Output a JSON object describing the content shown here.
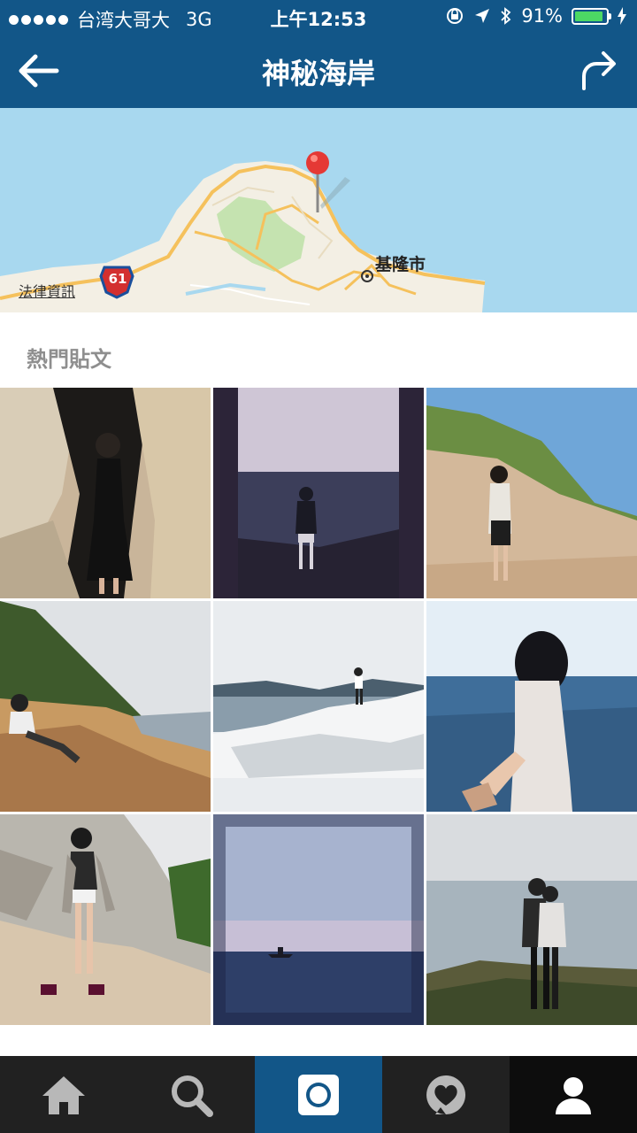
{
  "status_bar": {
    "carrier": "台湾大哥大",
    "network": "3G",
    "time": "上午12:53",
    "battery_percent": "91%",
    "battery_level": 0.91
  },
  "nav": {
    "title": "神秘海岸",
    "back_icon": "back-arrow-icon",
    "share_icon": "share-arrow-icon"
  },
  "map": {
    "legal_label": "法律資訊",
    "city_label": "基隆市",
    "route_badge": "61",
    "pin_color": "#e53935"
  },
  "section": {
    "title": "熱門貼文"
  },
  "posts": [
    {
      "subject": "girl in black dress in sea cave"
    },
    {
      "subject": "person standing on rocks facing sea, dark filter"
    },
    {
      "subject": "girl on sandstone cliff under blue sky"
    },
    {
      "subject": "man sitting on colorful rocks"
    },
    {
      "subject": "man standing on white rocks by sea"
    },
    {
      "subject": "follow-me hand holding toward sea"
    },
    {
      "subject": "girl posing on rocks"
    },
    {
      "subject": "boat on dark sea"
    },
    {
      "subject": "couple hugging on shore"
    }
  ],
  "tabbar": {
    "items": [
      "home-icon",
      "search-icon",
      "camera-icon",
      "activity-heart-icon",
      "profile-icon"
    ]
  },
  "colors": {
    "brand": "#125688",
    "tabbar": "#212121"
  }
}
